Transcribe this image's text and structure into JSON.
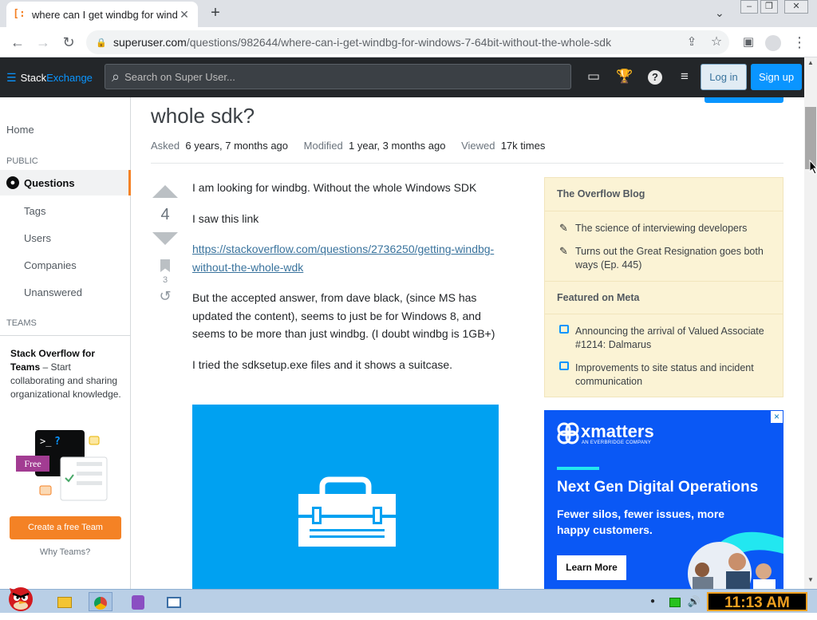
{
  "browser": {
    "tab_title": "where can I get windbg for windo",
    "tab_favicon": "[:",
    "new_tab": "+",
    "url_domain": "superuser.com",
    "url_path": "/questions/982644/where-can-i-get-windbg-for-windows-7-64bit-without-the-whole-sdk"
  },
  "header": {
    "logo_stack": "Stack",
    "logo_exchange": "Exchange",
    "search_placeholder": "Search on Super User...",
    "login": "Log in",
    "signup": "Sign up"
  },
  "leftnav": {
    "home": "Home",
    "public": "PUBLIC",
    "questions": "Questions",
    "tags": "Tags",
    "users": "Users",
    "companies": "Companies",
    "unanswered": "Unanswered",
    "teams_caption": "TEAMS",
    "teams_title": "Stack Overflow for Teams",
    "teams_desc": " – Start collaborating and sharing organizational knowledge.",
    "free_badge": "Free",
    "create_team": "Create a free Team",
    "why_teams": "Why Teams?"
  },
  "question": {
    "title_partial": "whole sdk?",
    "asked_label": "Asked",
    "asked_value": "6 years, 7 months ago",
    "modified_label": "Modified",
    "modified_value": "1 year, 3 months ago",
    "viewed_label": "Viewed",
    "viewed_value": "17k times",
    "votes": "4",
    "bookmarks": "3",
    "body": {
      "p1": "I am looking for windbg. Without the whole Windows SDK",
      "p2": "I saw this link",
      "link": "https://stackoverflow.com/questions/2736250/getting-windbg-without-the-whole-wdk",
      "p3": "But the accepted answer, from dave black, (since MS has updated the content), seems to just be for Windows 8, and seems to be more than just windbg. (I doubt windbg is 1GB+)",
      "p4": "I tried the sdksetup.exe files and it shows a suitcase."
    }
  },
  "sidebar": {
    "blog_header": "The Overflow Blog",
    "blog_items": [
      "The science of interviewing developers",
      "Turns out the Great Resignation goes both ways (Ep. 445)"
    ],
    "meta_header": "Featured on Meta",
    "meta_items": [
      "Announcing the arrival of Valued Associate #1214: Dalmarus",
      "Improvements to site status and incident communication"
    ]
  },
  "ad": {
    "brand": "xmatters",
    "brand_sub": "AN EVERBRIDGE COMPANY",
    "headline": "Next Gen Digital Operations",
    "subline": "Fewer silos, fewer issues, more happy customers.",
    "button": "Learn More",
    "close": "×"
  },
  "taskbar": {
    "clock": "11:13 AM"
  },
  "colors": {
    "accent_blue": "#0a95ff",
    "accent_orange": "#f48225",
    "header_dark": "#232629"
  }
}
